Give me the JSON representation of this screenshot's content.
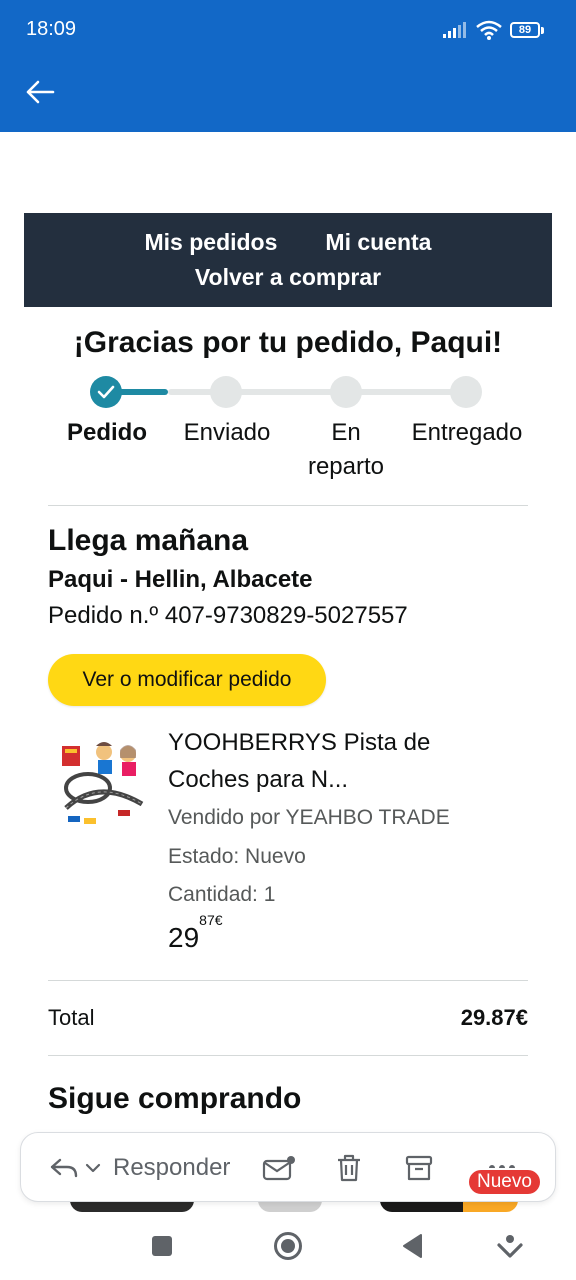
{
  "status_bar": {
    "time": "18:09",
    "battery": "89",
    "icons": [
      "signal-icon",
      "wifi-icon",
      "battery-icon"
    ]
  },
  "header": {
    "back_icon": "arrow-left-icon",
    "bg_color": "#1268c7"
  },
  "email": {
    "nav": {
      "my_orders": "Mis pedidos",
      "my_account": "Mi cuenta",
      "buy_again": "Volver a comprar"
    },
    "thanks_title": "¡Gracias por tu pedido, Paqui!",
    "progress": {
      "current_step": 1,
      "steps": [
        {
          "label": "Pedido"
        },
        {
          "label": "Enviado"
        },
        {
          "label_line1": "En",
          "label_line2": "reparto"
        },
        {
          "label": "Entregado"
        }
      ]
    },
    "arrival": "Llega mañana",
    "ship_to": "Paqui - Hellin, Albacete",
    "order_number": "Pedido n.º 407-9730829-5027557",
    "view_button": "Ver o modificar pedido",
    "item": {
      "title_line1": "YOOHBERRYS Pista de",
      "title_line2": "Coches para N...",
      "seller": "Vendido por YEAHBO TRADE",
      "condition": "Estado: Nuevo",
      "quantity": "Cantidad: 1",
      "price_whole": "29",
      "price_fraction": "87€"
    },
    "total_label": "Total",
    "total_value": "29.87€",
    "keep_shopping": "Sigue comprando"
  },
  "toolbar": {
    "reply_label": "Responder",
    "icons": [
      "reply-icon",
      "chevron-down-icon",
      "mail-unread-icon",
      "trash-icon",
      "archive-icon",
      "more-icon"
    ],
    "new_badge": "Nuevo"
  },
  "colors": {
    "accent_teal": "#1e8aa3",
    "button_yellow": "#ffd814",
    "nav_dark": "#232f3e",
    "badge_red": "#e53935"
  }
}
